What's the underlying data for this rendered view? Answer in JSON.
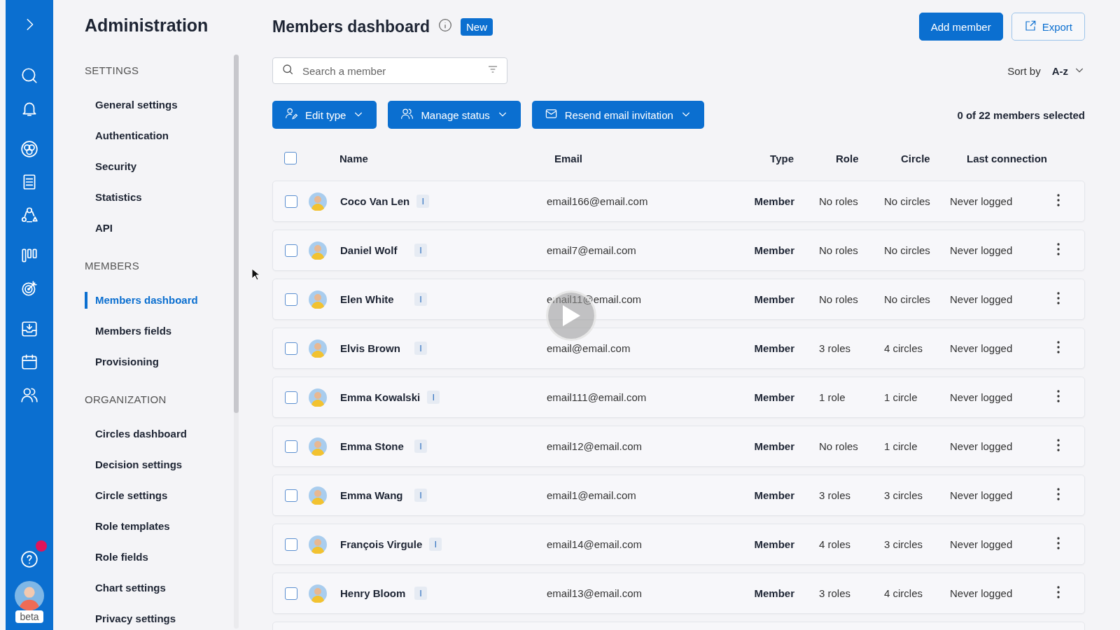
{
  "rail": {
    "beta_label": "beta",
    "help_has_notification": true
  },
  "sidebar": {
    "title": "Administration",
    "sections": [
      {
        "heading": "SETTINGS",
        "items": [
          {
            "label": "General settings",
            "selected": false
          },
          {
            "label": "Authentication",
            "selected": false
          },
          {
            "label": "Security",
            "selected": false
          },
          {
            "label": "Statistics",
            "selected": false
          },
          {
            "label": "API",
            "selected": false
          }
        ]
      },
      {
        "heading": "MEMBERS",
        "items": [
          {
            "label": "Members dashboard",
            "selected": true
          },
          {
            "label": "Members fields",
            "selected": false
          },
          {
            "label": "Provisioning",
            "selected": false
          }
        ]
      },
      {
        "heading": "ORGANIZATION",
        "items": [
          {
            "label": "Circles dashboard",
            "selected": false
          },
          {
            "label": "Decision settings",
            "selected": false
          },
          {
            "label": "Circle settings",
            "selected": false
          },
          {
            "label": "Role templates",
            "selected": false
          },
          {
            "label": "Role fields",
            "selected": false
          },
          {
            "label": "Chart settings",
            "selected": false
          },
          {
            "label": "Privacy settings",
            "selected": false
          }
        ]
      }
    ]
  },
  "main": {
    "title": "Members dashboard",
    "badge": "New",
    "add_button": "Add member",
    "export_button": "Export",
    "search": {
      "placeholder": "Search a member"
    },
    "sort_label": "Sort by",
    "sort_value": "A-z",
    "actions": [
      {
        "label": "Edit type",
        "kind": "edit"
      },
      {
        "label": "Manage status",
        "kind": "status"
      },
      {
        "label": "Resend email invitation",
        "kind": "email"
      }
    ],
    "selection_count": "0 of 22 members selected",
    "table": {
      "select_all_checked": false,
      "columns": [
        "Name",
        "Email",
        "Type",
        "Role",
        "Circle",
        "Last connection"
      ],
      "rows": [
        {
          "checked": false,
          "name": "Coco Van Len",
          "badge": "I",
          "email": "email166@email.com",
          "type": "Member",
          "role": "No roles",
          "circle": "No circles",
          "last_connection": "Never logged"
        },
        {
          "checked": false,
          "name": "Daniel Wolf",
          "badge": "I",
          "email": "email7@email.com",
          "type": "Member",
          "role": "No roles",
          "circle": "No circles",
          "last_connection": "Never logged"
        },
        {
          "checked": false,
          "name": "Elen White",
          "badge": "I",
          "email": "email11@email.com",
          "type": "Member",
          "role": "No roles",
          "circle": "No circles",
          "last_connection": "Never logged"
        },
        {
          "checked": false,
          "name": "Elvis Brown",
          "badge": "I",
          "email": "email@email.com",
          "type": "Member",
          "role": "3 roles",
          "circle": "4 circles",
          "last_connection": "Never logged"
        },
        {
          "checked": false,
          "name": "Emma Kowalski",
          "badge": "I",
          "email": "email111@email.com",
          "type": "Member",
          "role": "1 role",
          "circle": "1 circle",
          "last_connection": "Never logged"
        },
        {
          "checked": false,
          "name": "Emma Stone",
          "badge": "I",
          "email": "email12@email.com",
          "type": "Member",
          "role": "No roles",
          "circle": "1 circle",
          "last_connection": "Never logged"
        },
        {
          "checked": false,
          "name": "Emma Wang",
          "badge": "I",
          "email": "email1@email.com",
          "type": "Member",
          "role": "3 roles",
          "circle": "3 circles",
          "last_connection": "Never logged"
        },
        {
          "checked": false,
          "name": "François Virgule",
          "badge": "I",
          "email": "email14@email.com",
          "type": "Member",
          "role": "4 roles",
          "circle": "3 circles",
          "last_connection": "Never logged"
        },
        {
          "checked": false,
          "name": "Henry Bloom",
          "badge": "I",
          "email": "email13@email.com",
          "type": "Member",
          "role": "3 roles",
          "circle": "4 circles",
          "last_connection": "Never logged"
        }
      ]
    }
  }
}
